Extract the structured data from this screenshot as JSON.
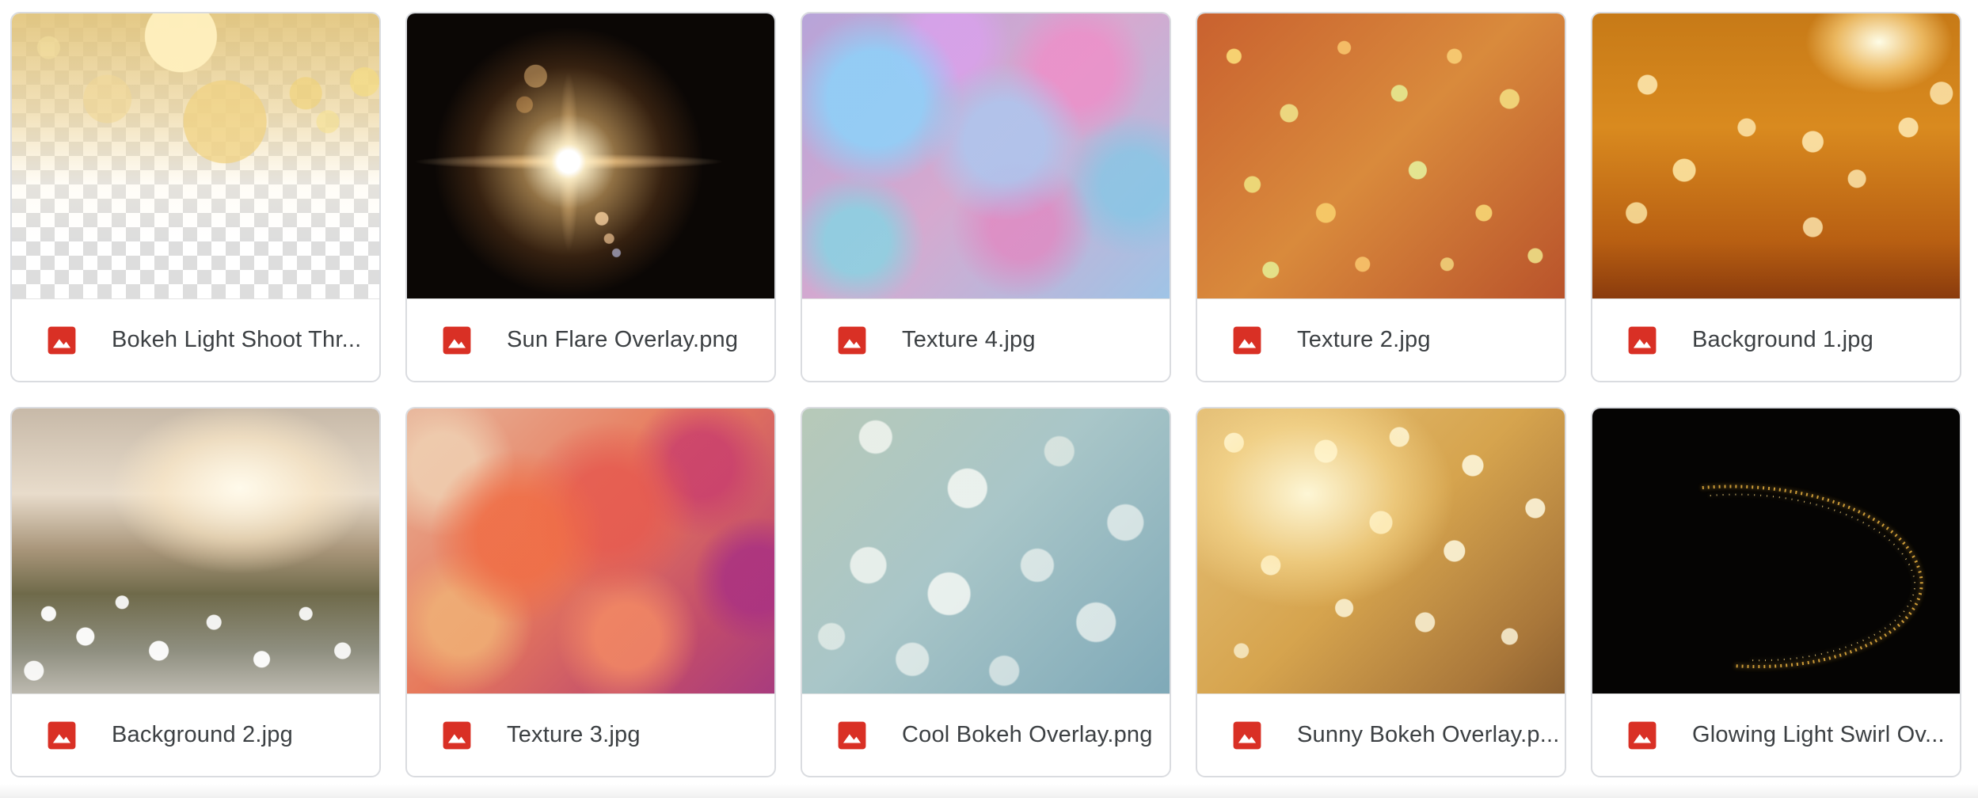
{
  "files": [
    {
      "name": "Bokeh Light Shoot Thr...",
      "icon": "image-file-icon",
      "thumb": "t-bokeh-transparent"
    },
    {
      "name": "Sun Flare Overlay.png",
      "icon": "image-file-icon",
      "thumb": "t-sun-flare"
    },
    {
      "name": "Texture 4.jpg",
      "icon": "image-file-icon",
      "thumb": "t-texture4"
    },
    {
      "name": "Texture 2.jpg",
      "icon": "image-file-icon",
      "thumb": "t-texture2"
    },
    {
      "name": "Background 1.jpg",
      "icon": "image-file-icon",
      "thumb": "t-background1"
    },
    {
      "name": "Background 2.jpg",
      "icon": "image-file-icon",
      "thumb": "t-background2"
    },
    {
      "name": "Texture 3.jpg",
      "icon": "image-file-icon",
      "thumb": "t-texture3"
    },
    {
      "name": "Cool Bokeh Overlay.png",
      "icon": "image-file-icon",
      "thumb": "t-cool-bokeh"
    },
    {
      "name": "Sunny Bokeh Overlay.p...",
      "icon": "image-file-icon",
      "thumb": "t-sunny-bokeh"
    },
    {
      "name": "Glowing Light Swirl Ov...",
      "icon": "image-file-icon",
      "thumb": "t-glowing-swirl"
    }
  ],
  "colors": {
    "icon_red": "#d93025",
    "text": "#3c4043",
    "border": "#dadce0"
  }
}
